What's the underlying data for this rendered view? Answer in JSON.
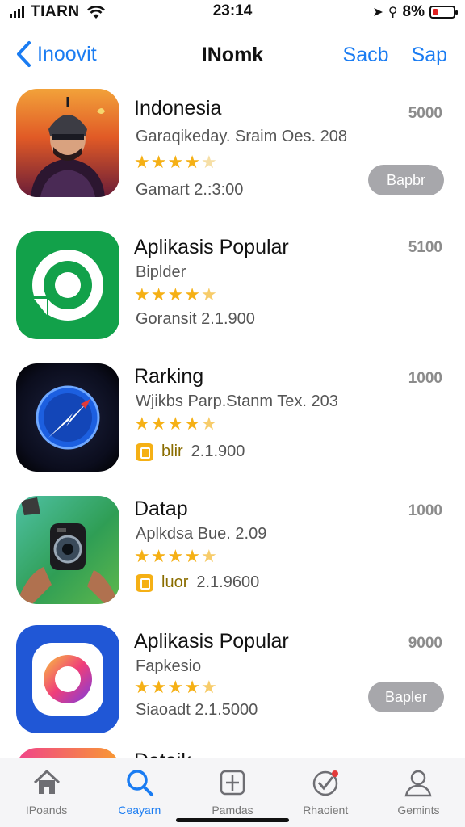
{
  "status_bar": {
    "carrier": "TIARN",
    "time": "23:14",
    "battery_percent": "8%",
    "battery_level": 0.08
  },
  "nav": {
    "back_label": "Inoovit",
    "title": "INomk",
    "action_1": "Sacb",
    "action_2": "Sap",
    "accent_color": "#1a7cf2"
  },
  "apps": [
    {
      "name": "Indonesia",
      "subtitle": "Garaqikeday. Sraim Oes. 208",
      "rating": 4.5,
      "meta": "Gamart   2.:3:00",
      "count": "5000",
      "button": "Bapbr",
      "icon": "ninja-character-icon"
    },
    {
      "name": "Aplikasis Popular",
      "subtitle": "Biplder",
      "rating": 4.5,
      "meta": "Goransit   2.1.900",
      "count": "5100",
      "icon": "green-target-icon"
    },
    {
      "name": "Rarking",
      "subtitle": "Wjikbs Parp.Stanm Tex. 203",
      "rating": 4.5,
      "meta_tag": "blir",
      "meta_value": "2.1.900",
      "count": "1000",
      "icon": "compass-icon"
    },
    {
      "name": "Datap",
      "subtitle": "Aplkdsa Bue. 2.09",
      "rating": 4.5,
      "meta_tag": "luor",
      "meta_value": "2.1.9600",
      "count": "1000",
      "icon": "camera-icon"
    },
    {
      "name": "Aplikasis Popular",
      "subtitle": "Fapkesio",
      "rating": 4.5,
      "meta": "Siaoadt   2.1.5000",
      "count": "9000",
      "button": "Bapler",
      "icon": "camera-lens-icon"
    },
    {
      "name": "Dataik",
      "icon": "gradient-app-icon"
    }
  ],
  "tabs": [
    {
      "label": "IPoands",
      "icon": "home-icon"
    },
    {
      "label": "Ceayarn",
      "icon": "search-icon",
      "active": true
    },
    {
      "label": "Pamdas",
      "icon": "apps-icon"
    },
    {
      "label": "Rhaoient",
      "icon": "updates-icon"
    },
    {
      "label": "Gemints",
      "icon": "profile-icon"
    }
  ]
}
